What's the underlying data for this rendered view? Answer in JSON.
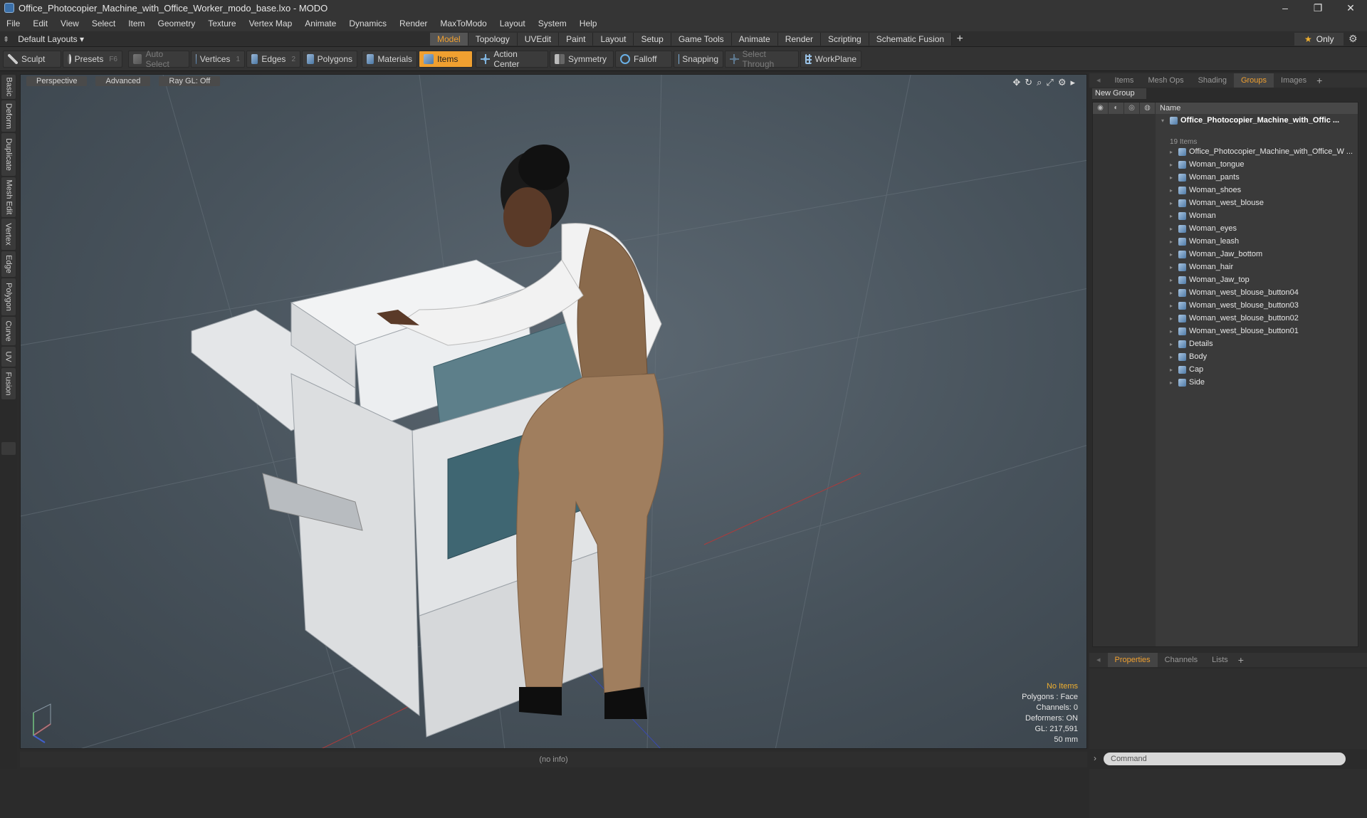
{
  "window": {
    "title": "Office_Photocopier_Machine_with_Office_Worker_modo_base.lxo - MODO",
    "controls": [
      "–",
      "❐",
      "✕"
    ]
  },
  "menu": [
    "File",
    "Edit",
    "View",
    "Select",
    "Item",
    "Geometry",
    "Texture",
    "Vertex Map",
    "Animate",
    "Dynamics",
    "Render",
    "MaxToModo",
    "Layout",
    "System",
    "Help"
  ],
  "layout": {
    "selector": "Default Layouts ▾",
    "tabs": [
      "Model",
      "Topology",
      "UVEdit",
      "Paint",
      "Layout",
      "Setup",
      "Game Tools",
      "Animate",
      "Render",
      "Scripting",
      "Schematic Fusion"
    ],
    "active": "Model",
    "only": "Only"
  },
  "toolbar": {
    "sculpt": "Sculpt",
    "presets": "Presets",
    "presets_key": "F6",
    "auto_select": "Auto Select",
    "vertices": "Vertices",
    "vertices_key": "1",
    "edges": "Edges",
    "edges_key": "2",
    "polygons": "Polygons",
    "materials": "Materials",
    "items": "Items",
    "action_center": "Action Center",
    "symmetry": "Symmetry",
    "falloff": "Falloff",
    "snapping": "Snapping",
    "select_through": "Select Through",
    "workplane": "WorkPlane"
  },
  "left_tabs": [
    "Basic",
    "Deform",
    "Duplicate",
    "Mesh Edit",
    "Vertex",
    "Edge",
    "Polygon",
    "Curve",
    "UV",
    "Fusion"
  ],
  "viewport": {
    "buttons": [
      "Perspective",
      "Advanced",
      "Ray GL: Off"
    ],
    "info": {
      "no_items": "No Items",
      "polygons": "Polygons : Face",
      "channels": "Channels: 0",
      "deformers": "Deformers: ON",
      "gl": "GL: 217,591",
      "focal": "50 mm"
    }
  },
  "status": "(no info)",
  "panel": {
    "tabs": [
      "Items",
      "Mesh Ops",
      "Shading",
      "Groups",
      "Images"
    ],
    "active_tab": "Groups",
    "new_group": "New Group",
    "name_col": "Name",
    "root": "Office_Photocopier_Machine_with_Offic ...",
    "root_sub": "19 Items",
    "items": [
      "Office_Photocopier_Machine_with_Office_W ...",
      "Woman_tongue",
      "Woman_pants",
      "Woman_shoes",
      "Woman_west_blouse",
      "Woman",
      "Woman_eyes",
      "Woman_leash",
      "Woman_Jaw_bottom",
      "Woman_hair",
      "Woman_Jaw_top",
      "Woman_west_blouse_button04",
      "Woman_west_blouse_button03",
      "Woman_west_blouse_button02",
      "Woman_west_blouse_button01",
      "Details",
      "Body",
      "Cap",
      "Side"
    ],
    "bottom_tabs": [
      "Properties",
      "Channels",
      "Lists"
    ],
    "bottom_active": "Properties",
    "command_placeholder": "Command"
  }
}
